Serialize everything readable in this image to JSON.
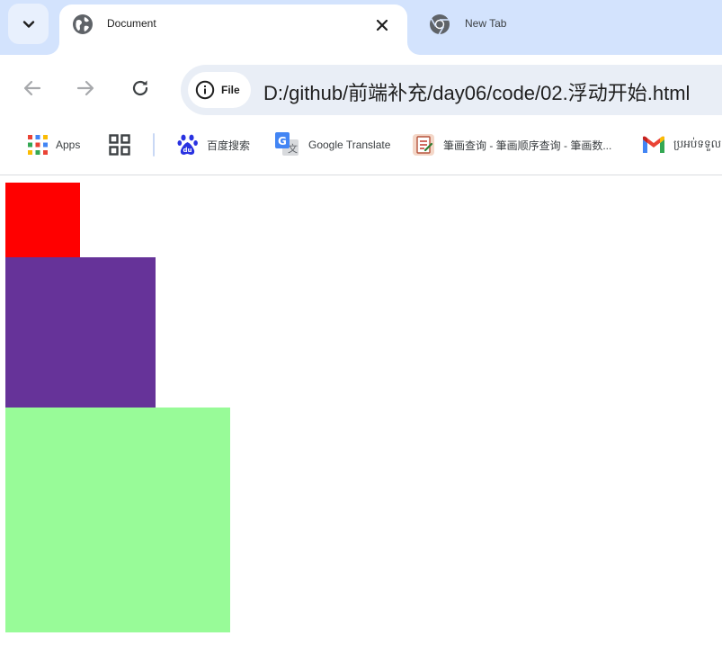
{
  "browser": {
    "tabs": [
      {
        "title": "Document",
        "active": true,
        "icon": "globe-icon"
      },
      {
        "title": "New Tab",
        "active": false,
        "icon": "chrome-icon"
      }
    ],
    "address_bar": {
      "scheme_chip": "File",
      "url": "D:/github/前端补充/day06/code/02.浮动开始.html"
    },
    "bookmarks": [
      {
        "label": "Apps",
        "icon": "apps-grid-icon"
      },
      {
        "label": "",
        "icon": "tab-groups-icon"
      },
      {
        "label": "百度搜索",
        "icon": "baidu-paw-icon"
      },
      {
        "label": "Google Translate",
        "icon": "google-translate-icon"
      },
      {
        "label": "筆画查询 - 筆画顺序查询 - 筆画数...",
        "icon": "stroke-order-icon"
      },
      {
        "label": "ប្រអប់ទទួល",
        "icon": "gmail-icon"
      }
    ]
  },
  "page": {
    "boxes": [
      {
        "name": "red-box",
        "color": "#ff0000"
      },
      {
        "name": "purple-box",
        "color": "#663399"
      },
      {
        "name": "green-box",
        "color": "#98fb98"
      }
    ]
  }
}
